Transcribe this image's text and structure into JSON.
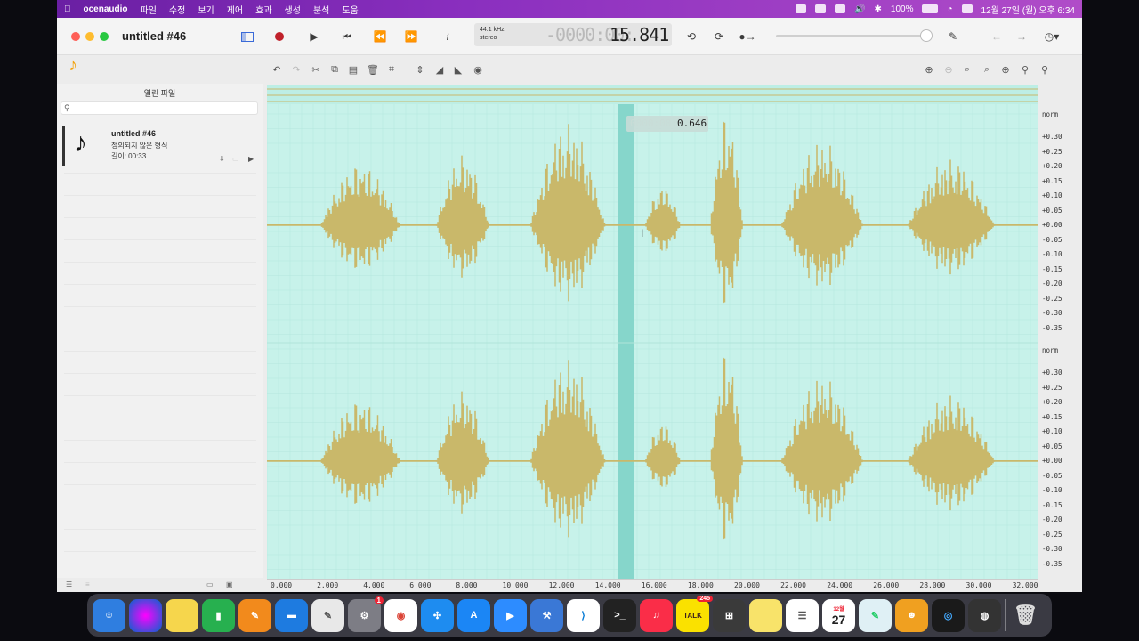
{
  "menubar": {
    "app_name": "ocenaudio",
    "items": [
      "파일",
      "수정",
      "보기",
      "제어",
      "효과",
      "생성",
      "분석",
      "도움"
    ],
    "battery": "100%",
    "clock": "12월 27일 (월) 오후 6:34"
  },
  "window": {
    "title": "untitled #46",
    "sample_rate": "44.1 kHz",
    "channels": "stereo",
    "time_dim": "-0000:00:",
    "time_value": "15.841",
    "volume": 1.0
  },
  "sidebar": {
    "header": "열린 파일",
    "search_placeholder": "",
    "file": {
      "name": "untitled #46",
      "format": "정의되지 않은 형식",
      "length": "길이: 00:33"
    }
  },
  "waveform": {
    "selection_time_dim": "0000:00:0",
    "selection_time": "0.646"
  },
  "amplitude_axis": {
    "norm_label": "norm",
    "labels": [
      "+0.30",
      "+0.25",
      "+0.20",
      "+0.15",
      "+0.10",
      "+0.05",
      "+0.00",
      "-0.05",
      "-0.10",
      "-0.15",
      "-0.20",
      "-0.25",
      "-0.30",
      "-0.35"
    ]
  },
  "time_axis": {
    "labels": [
      "0.000",
      "2.000",
      "4.000",
      "6.000",
      "8.000",
      "10.000",
      "12.000",
      "14.000",
      "16.000",
      "18.000",
      "20.000",
      "22.000",
      "24.000",
      "26.000",
      "28.000",
      "30.000",
      "32.000"
    ]
  },
  "dock": {
    "kakaotalk_badge": "245",
    "settings_badge": "1",
    "calendar_month": "12월",
    "calendar_day": "27"
  },
  "colors": {
    "wave": "#c9b86a",
    "background": "#c7f2ea",
    "selection": "#86d6cb"
  }
}
